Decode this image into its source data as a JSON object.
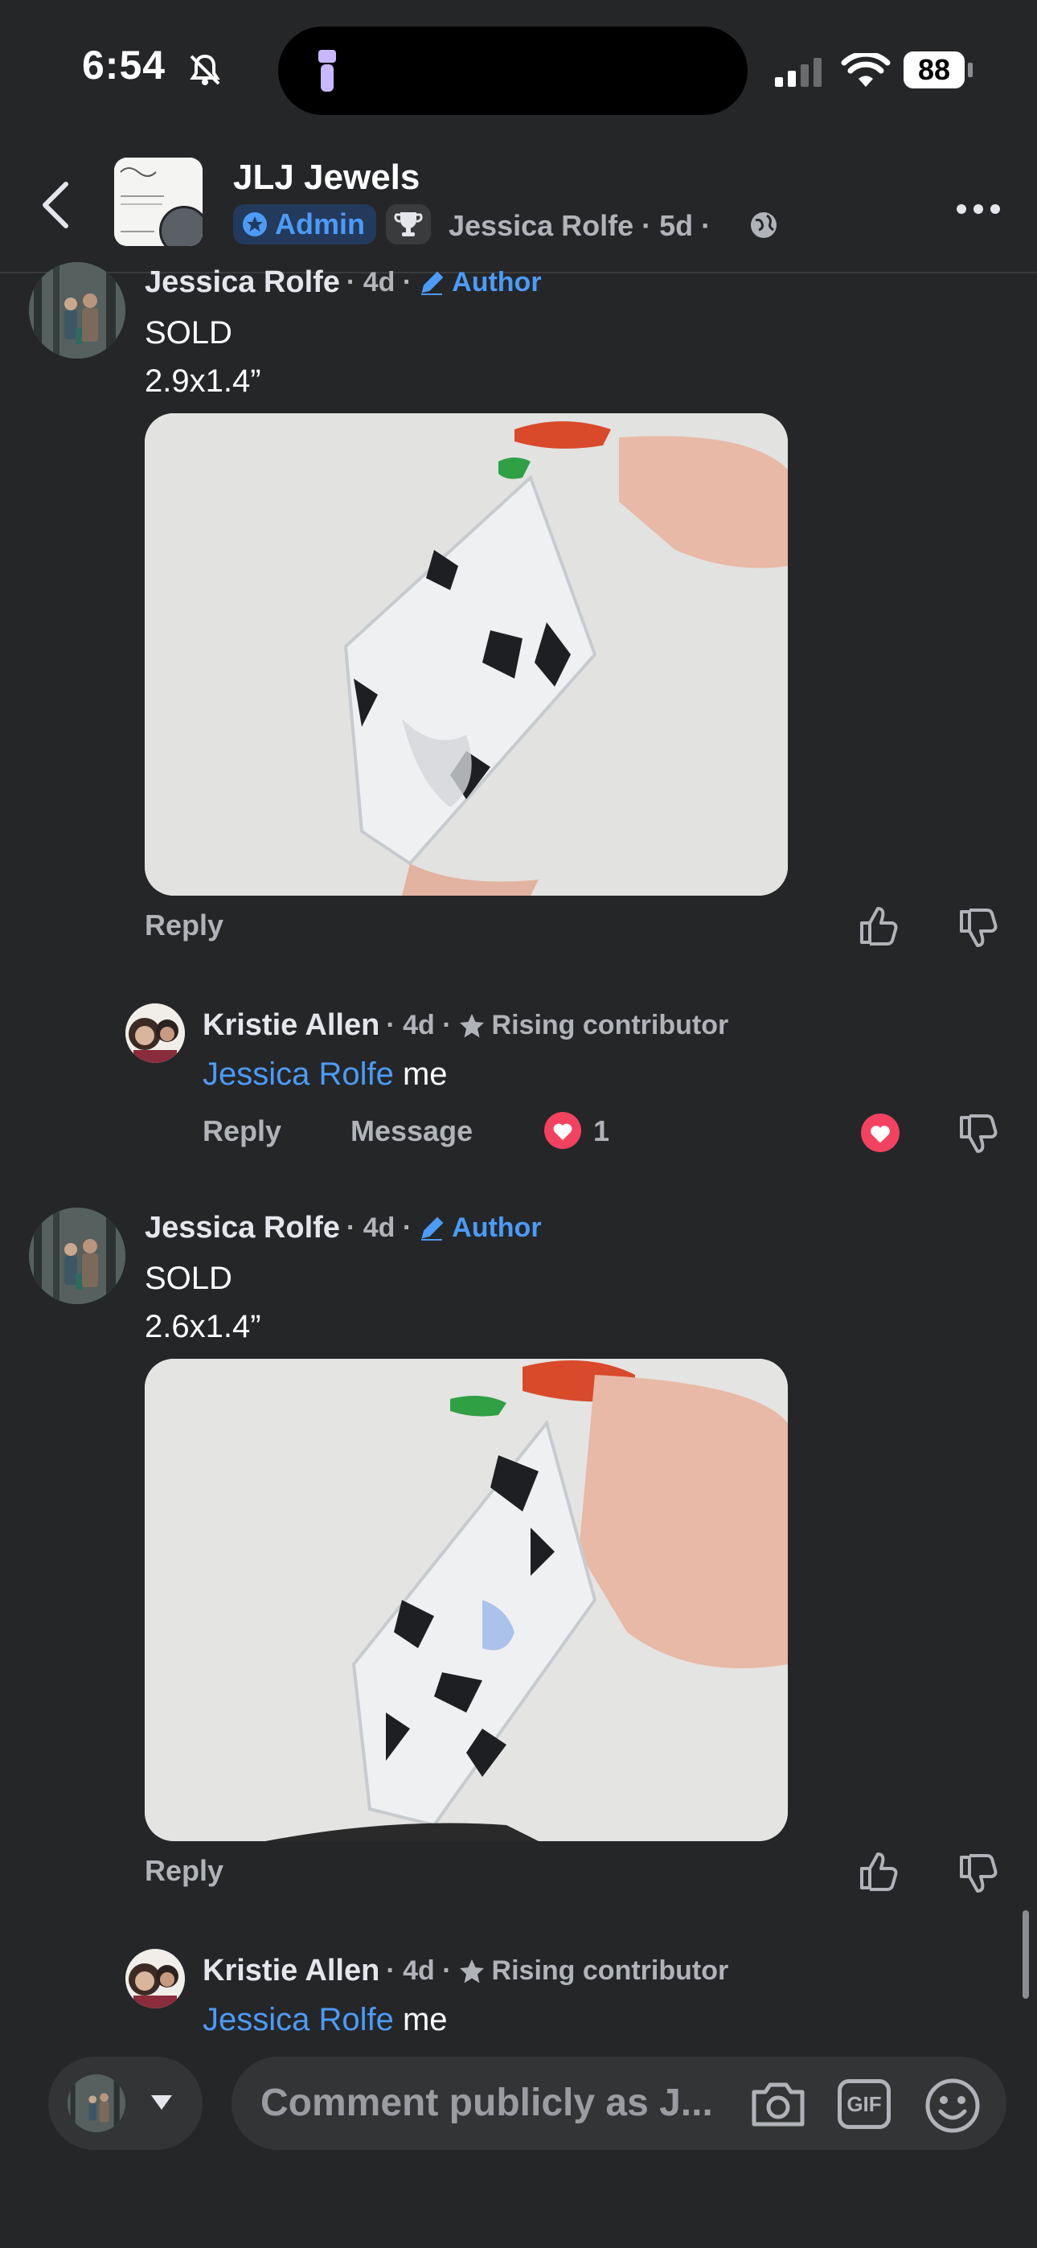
{
  "status_bar": {
    "time": "6:54",
    "battery": "88"
  },
  "header": {
    "group_name": "JLJ Jewels",
    "admin_label": "Admin",
    "meta": "Jessica Rolfe · 5d ·"
  },
  "comments": [
    {
      "name": "Jessica Rolfe",
      "meta": "· 4d ·",
      "badge": "Author",
      "lines": [
        "SOLD",
        "2.9x1.4”"
      ],
      "reply_label": "Reply"
    },
    {
      "name": "Kristie Allen",
      "meta": "· 4d ·",
      "badge": "Rising contributor",
      "mention": "Jessica Rolfe",
      "text": " me",
      "reply_label": "Reply",
      "message_label": "Message",
      "reaction_count": "1"
    },
    {
      "name": "Jessica Rolfe",
      "meta": "· 4d ·",
      "badge": "Author",
      "lines": [
        "SOLD",
        "2.6x1.4”"
      ],
      "reply_label": "Reply"
    },
    {
      "name": "Kristie Allen",
      "meta": "· 4d ·",
      "badge": "Rising contributor",
      "mention": "Jessica Rolfe",
      "text": " me"
    }
  ],
  "composer": {
    "placeholder": "Comment publicly as J...",
    "gif_label": "GIF"
  },
  "colors": {
    "background": "#252628",
    "link_blue": "#4c9bf7",
    "secondary_text": "#b0b3b8",
    "love_red": "#f3425f"
  }
}
